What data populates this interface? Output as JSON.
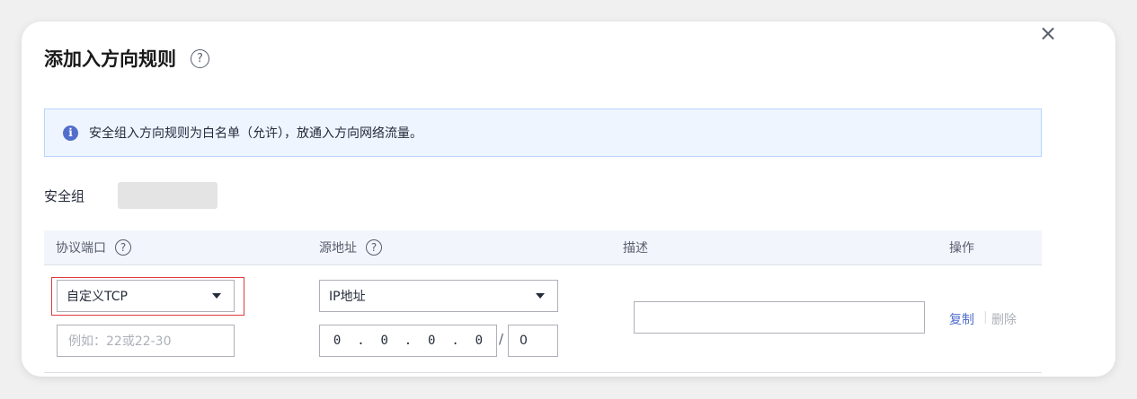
{
  "dialog": {
    "title": "添加入方向规则",
    "help_icon": "question-icon",
    "close_symbol": "×"
  },
  "notice": {
    "icon_glyph": "i",
    "text": "安全组入方向规则为白名单（允许），放通入方向网络流量。"
  },
  "security_group": {
    "label": "安全组"
  },
  "table": {
    "headers": {
      "protocol_port": "协议端口",
      "source": "源地址",
      "description": "描述",
      "actions": "操作"
    },
    "row": {
      "protocol_select": "自定义TCP",
      "port_placeholder": "例如：22或22-30",
      "source_type_select": "IP地址",
      "ip_octets": [
        "0",
        "0",
        "0",
        "0"
      ],
      "ip_separator": ".",
      "slash": "/",
      "mask": "0",
      "description_value": "",
      "copy_label": "复制",
      "separator": "|",
      "delete_label": "删除"
    }
  },
  "colors": {
    "accent": "#526ecc",
    "highlight_border": "#e0393e",
    "notice_bg": "#eef5ff"
  }
}
